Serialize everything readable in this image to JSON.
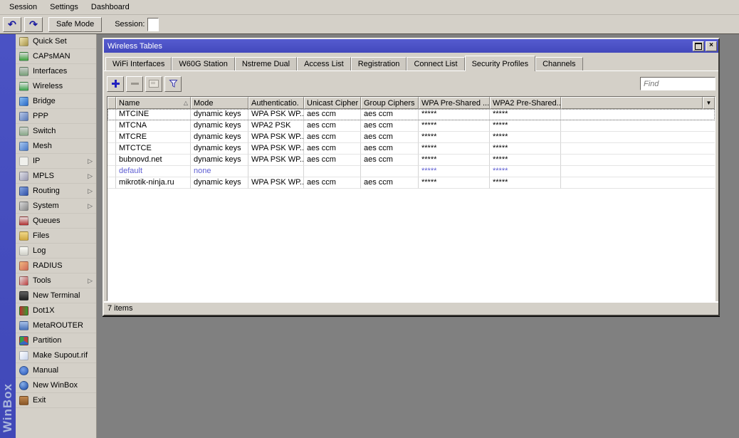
{
  "menubar": {
    "items": [
      "Session",
      "Settings",
      "Dashboard"
    ]
  },
  "toolbar": {
    "safe_mode": "Safe Mode",
    "session_label": "Session:"
  },
  "sidebar": {
    "winbox_label": "WinBox",
    "items": [
      {
        "label": "Quick Set",
        "icon": "quickset-icon",
        "arrow": false
      },
      {
        "label": "CAPsMAN",
        "icon": "capsman-icon",
        "arrow": false
      },
      {
        "label": "Interfaces",
        "icon": "interfaces-icon",
        "arrow": false
      },
      {
        "label": "Wireless",
        "icon": "wireless-icon",
        "arrow": false
      },
      {
        "label": "Bridge",
        "icon": "bridge-icon",
        "arrow": false
      },
      {
        "label": "PPP",
        "icon": "ppp-icon",
        "arrow": false
      },
      {
        "label": "Switch",
        "icon": "switch-icon",
        "arrow": false
      },
      {
        "label": "Mesh",
        "icon": "mesh-icon",
        "arrow": false
      },
      {
        "label": "IP",
        "icon": "ip-icon",
        "arrow": true
      },
      {
        "label": "MPLS",
        "icon": "mpls-icon",
        "arrow": true
      },
      {
        "label": "Routing",
        "icon": "routing-icon",
        "arrow": true
      },
      {
        "label": "System",
        "icon": "system-icon",
        "arrow": true
      },
      {
        "label": "Queues",
        "icon": "queues-icon",
        "arrow": false
      },
      {
        "label": "Files",
        "icon": "files-icon",
        "arrow": false
      },
      {
        "label": "Log",
        "icon": "log-icon",
        "arrow": false
      },
      {
        "label": "RADIUS",
        "icon": "radius-icon",
        "arrow": false
      },
      {
        "label": "Tools",
        "icon": "tools-icon",
        "arrow": true
      },
      {
        "label": "New Terminal",
        "icon": "terminal-icon",
        "arrow": false
      },
      {
        "label": "Dot1X",
        "icon": "dot1x-icon",
        "arrow": false
      },
      {
        "label": "MetaROUTER",
        "icon": "metarouter-icon",
        "arrow": false
      },
      {
        "label": "Partition",
        "icon": "partition-icon",
        "arrow": false
      },
      {
        "label": "Make Supout.rif",
        "icon": "supout-icon",
        "arrow": false
      },
      {
        "label": "Manual",
        "icon": "manual-icon",
        "arrow": false
      },
      {
        "label": "New WinBox",
        "icon": "newwinbox-icon",
        "arrow": false
      },
      {
        "label": "Exit",
        "icon": "exit-icon",
        "arrow": false
      }
    ]
  },
  "window": {
    "title": "Wireless Tables",
    "tabs": [
      "WiFi Interfaces",
      "W60G Station",
      "Nstreme Dual",
      "Access List",
      "Registration",
      "Connect List",
      "Security Profiles",
      "Channels"
    ],
    "active_tab": "Security Profiles",
    "find_placeholder": "Find",
    "status": "7 items",
    "table": {
      "headers": [
        {
          "label": "Name",
          "sorted": true
        },
        {
          "label": "Mode"
        },
        {
          "label": "Authenticatio."
        },
        {
          "label": "Unicast Cipher"
        },
        {
          "label": "Group Ciphers"
        },
        {
          "label": "WPA Pre-Shared ..."
        },
        {
          "label": "WPA2 Pre-Shared.."
        }
      ],
      "rows": [
        {
          "cells": [
            "MTCINE",
            "dynamic keys",
            "WPA PSK WP...",
            "aes ccm",
            "aes ccm",
            "*****",
            "*****"
          ],
          "selected": true
        },
        {
          "cells": [
            "MTCNA",
            "dynamic keys",
            "WPA2 PSK",
            "aes ccm",
            "aes ccm",
            "*****",
            "*****"
          ]
        },
        {
          "cells": [
            "MTCRE",
            "dynamic keys",
            "WPA PSK WP...",
            "aes ccm",
            "aes ccm",
            "*****",
            "*****"
          ]
        },
        {
          "cells": [
            "MTCTCE",
            "dynamic keys",
            "WPA PSK WP...",
            "aes ccm",
            "aes ccm",
            "*****",
            "*****"
          ]
        },
        {
          "cells": [
            "bubnovd.net",
            "dynamic keys",
            "WPA PSK WP...",
            "aes ccm",
            "aes ccm",
            "*****",
            "*****"
          ]
        },
        {
          "cells": [
            "default",
            "none",
            "",
            "",
            "",
            "*****",
            "*****"
          ],
          "muted": true
        },
        {
          "cells": [
            "mikrotik-ninja.ru",
            "dynamic keys",
            "WPA PSK WP...",
            "aes ccm",
            "aes ccm",
            "*****",
            "*****"
          ]
        }
      ]
    }
  },
  "colors": {
    "titlebar_blue": "#4b50c8",
    "brand_strip_blue": "#4a52c4",
    "muted_row_text": "#5f5fd3",
    "workspace_gray": "#808080",
    "chrome_gray": "#d4d0c8"
  }
}
